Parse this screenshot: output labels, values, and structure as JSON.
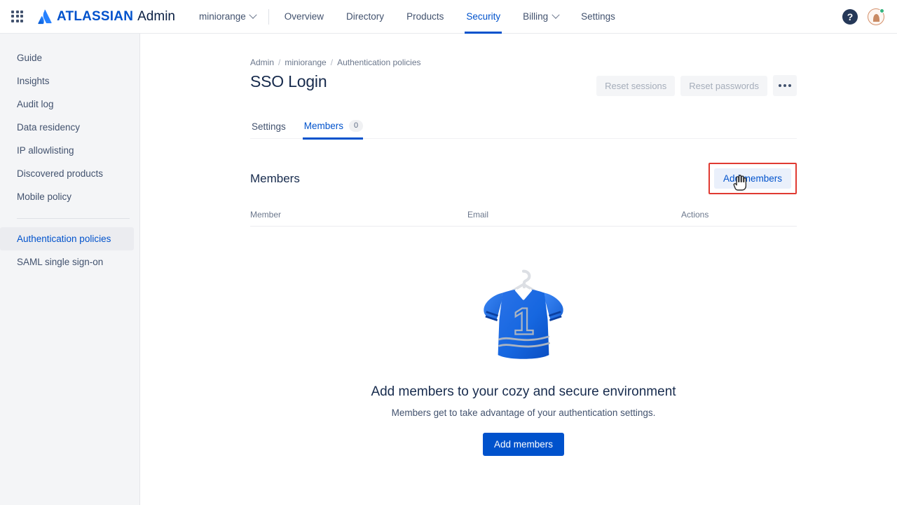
{
  "topnav": {
    "app_switcher_icon": "grid-apps-icon",
    "brand_logo_icon": "atlassian-logo-icon",
    "brand_name": "ATLASSIAN",
    "brand_product": "Admin",
    "org_name": "miniorange",
    "org_chevron_icon": "chevron-down-icon",
    "links": [
      {
        "label": "Overview",
        "active": false
      },
      {
        "label": "Directory",
        "active": false
      },
      {
        "label": "Products",
        "active": false
      },
      {
        "label": "Security",
        "active": true
      },
      {
        "label": "Billing",
        "active": false,
        "has_chevron": true
      },
      {
        "label": "Settings",
        "active": false
      }
    ],
    "help_icon": "help-question-icon",
    "help_glyph": "?",
    "avatar_icon": "user-avatar-icon",
    "avatar_status": "online",
    "accent_color": "#0052cc"
  },
  "sidebar": {
    "items": [
      {
        "label": "Guide",
        "selected": false
      },
      {
        "label": "Insights",
        "selected": false
      },
      {
        "label": "Audit log",
        "selected": false
      },
      {
        "label": "Data residency",
        "selected": false
      },
      {
        "label": "IP allowlisting",
        "selected": false
      },
      {
        "label": "Discovered products",
        "selected": false
      },
      {
        "label": "Mobile policy",
        "selected": false
      }
    ],
    "items_after_divider": [
      {
        "label": "Authentication policies",
        "selected": true
      },
      {
        "label": "SAML single sign-on",
        "selected": false
      }
    ],
    "background_color": "#f4f5f7",
    "selected_color": "#0052cc"
  },
  "main": {
    "breadcrumb": [
      {
        "label": "Admin"
      },
      {
        "label": "miniorange"
      },
      {
        "label": "Authentication policies"
      }
    ],
    "breadcrumb_separator": "/",
    "page_title": "SSO Login",
    "title_actions": {
      "reset_sessions_label": "Reset sessions",
      "reset_sessions_disabled": true,
      "reset_passwords_label": "Reset passwords",
      "reset_passwords_disabled": true,
      "more_icon": "more-horizontal-icon"
    },
    "tabs": [
      {
        "label": "Settings",
        "active": false,
        "badge": null
      },
      {
        "label": "Members",
        "active": true,
        "badge": "0"
      }
    ],
    "section_title": "Members",
    "add_members_label": "Add members",
    "highlight_color": "#e03a32",
    "cursor_icon": "pointing-hand-cursor",
    "table": {
      "columns": [
        "Member",
        "Email",
        "Actions"
      ],
      "rows": []
    },
    "empty_state": {
      "illustration_icon": "jersey-on-hanger-icon",
      "jersey_number": "1",
      "title": "Add members to your cozy and secure environment",
      "subtitle": "Members get to take advantage of your authentication settings.",
      "button_label": "Add members",
      "button_color": "#0052cc"
    }
  }
}
